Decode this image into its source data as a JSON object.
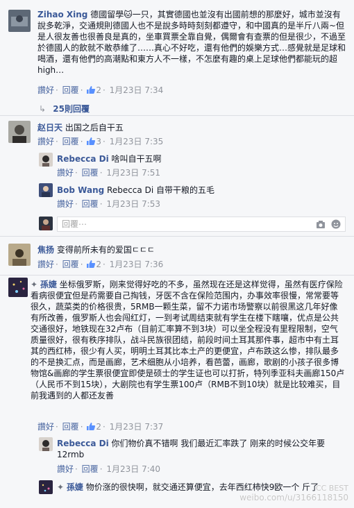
{
  "thread1": {
    "author": "Zihao Xing",
    "text": "德國留學🐱一只，其實德國也並沒有出國前想的那麼好，城市並沒有說多乾淨，交通規則德國人也不是說多時時刻刻都遵守，和中國真的是半斤八兩~但是人很友善也很善良是真的，坐車買票全靠自覺，偶爾會有查票的但是很少，不過至於德國人的飲就不敢恭維了……真心不好吃，還有他們的娛樂方式…感覺就是足球和喝酒，還有他們的高潮點和東方人不一樣，不怎麼有趣的桌上足球他們都能玩的超high…",
    "like": "讚好",
    "reply": "回覆",
    "likes": "2",
    "time": "1月23日 7:34",
    "replies_link": "25則回覆"
  },
  "thread2": {
    "author": "赵日天",
    "text": "出国之后自干五",
    "like": "讚好",
    "reply": "回覆",
    "likes": "3",
    "time": "1月23日 7:35",
    "replies": [
      {
        "author": "Rebecca Di",
        "text": "啥叫自干五啊",
        "like": "讚好",
        "reply": "回覆",
        "time": "1月23日 7:51"
      },
      {
        "author": "Bob Wang",
        "text": "Rebecca Di 自带干粮的五毛",
        "like": "讚好",
        "reply": "回覆",
        "time": "1月23日 7:53"
      }
    ],
    "reply_placeholder": "回覆⋯"
  },
  "thread3": {
    "author": "焦扬",
    "text": "变得前所未有的爱国ㄷㄷㄷ",
    "like": "讚好",
    "reply": "回覆",
    "likes": "2",
    "time": "1月23日 7:36"
  },
  "thread4": {
    "author": "孫婕",
    "text": "坐标俄罗斯，刚来觉得好吃的不多，虽然现在还是这样觉得，虽然有医疗保险看病很便宜但是药需要自己掏钱，牙医不含在保险范围内，办事效率很慢，常常要等很久，蔬菜类的价格很贵，5RMB一颗生菜，留不力诺市场警察以前很黑这几年好像有所改善，俄罗斯人也会闯红灯，一到考试周结束就有学生在楼下瞎嚷，优点是公共交通很好，地铁现在32卢布（目前汇率算不到3块）可以坐全程没有里程限制，空气质量很好，很有秩序排队，战斗民族很团结，前段时间土耳其那件事，超市中有土耳其的西红柿，很少有人买，明明土耳其比本土产的更便宜，卢布跌这么惨，排队最多的不是换汇点，而是画廊，艺术细胞从小培养，看芭蕾，画廊，歌剧的小孩子很多博物馆&画廊的学生票很便宜即使是硕士的学生证也可以打折，特列季亚科夫画廊150卢（人民币不到15块），大剧院也有学生票100卢（RMB不到10块）就是比较难买，目前我遇到的人都还友善",
    "like": "讚好",
    "reply": "回覆",
    "likes": "2",
    "time": "1月23日 7:37",
    "replies": [
      {
        "author": "Rebecca Di",
        "text": "你们物价真不错啊 我们最近汇率跌了 刚来的时候公交年要12rmb",
        "like": "讚好",
        "reply": "回覆",
        "time": "1月23日 7:40"
      },
      {
        "author": "孫婕",
        "text": "物价涨的很快啊，就交通还算便宜，去年西红柿快9欧一个 斤了",
        "like": "",
        "reply": "",
        "time": ""
      }
    ]
  },
  "watermark": "weibo.com/u/3166118150",
  "watermark2": "CC BEST"
}
